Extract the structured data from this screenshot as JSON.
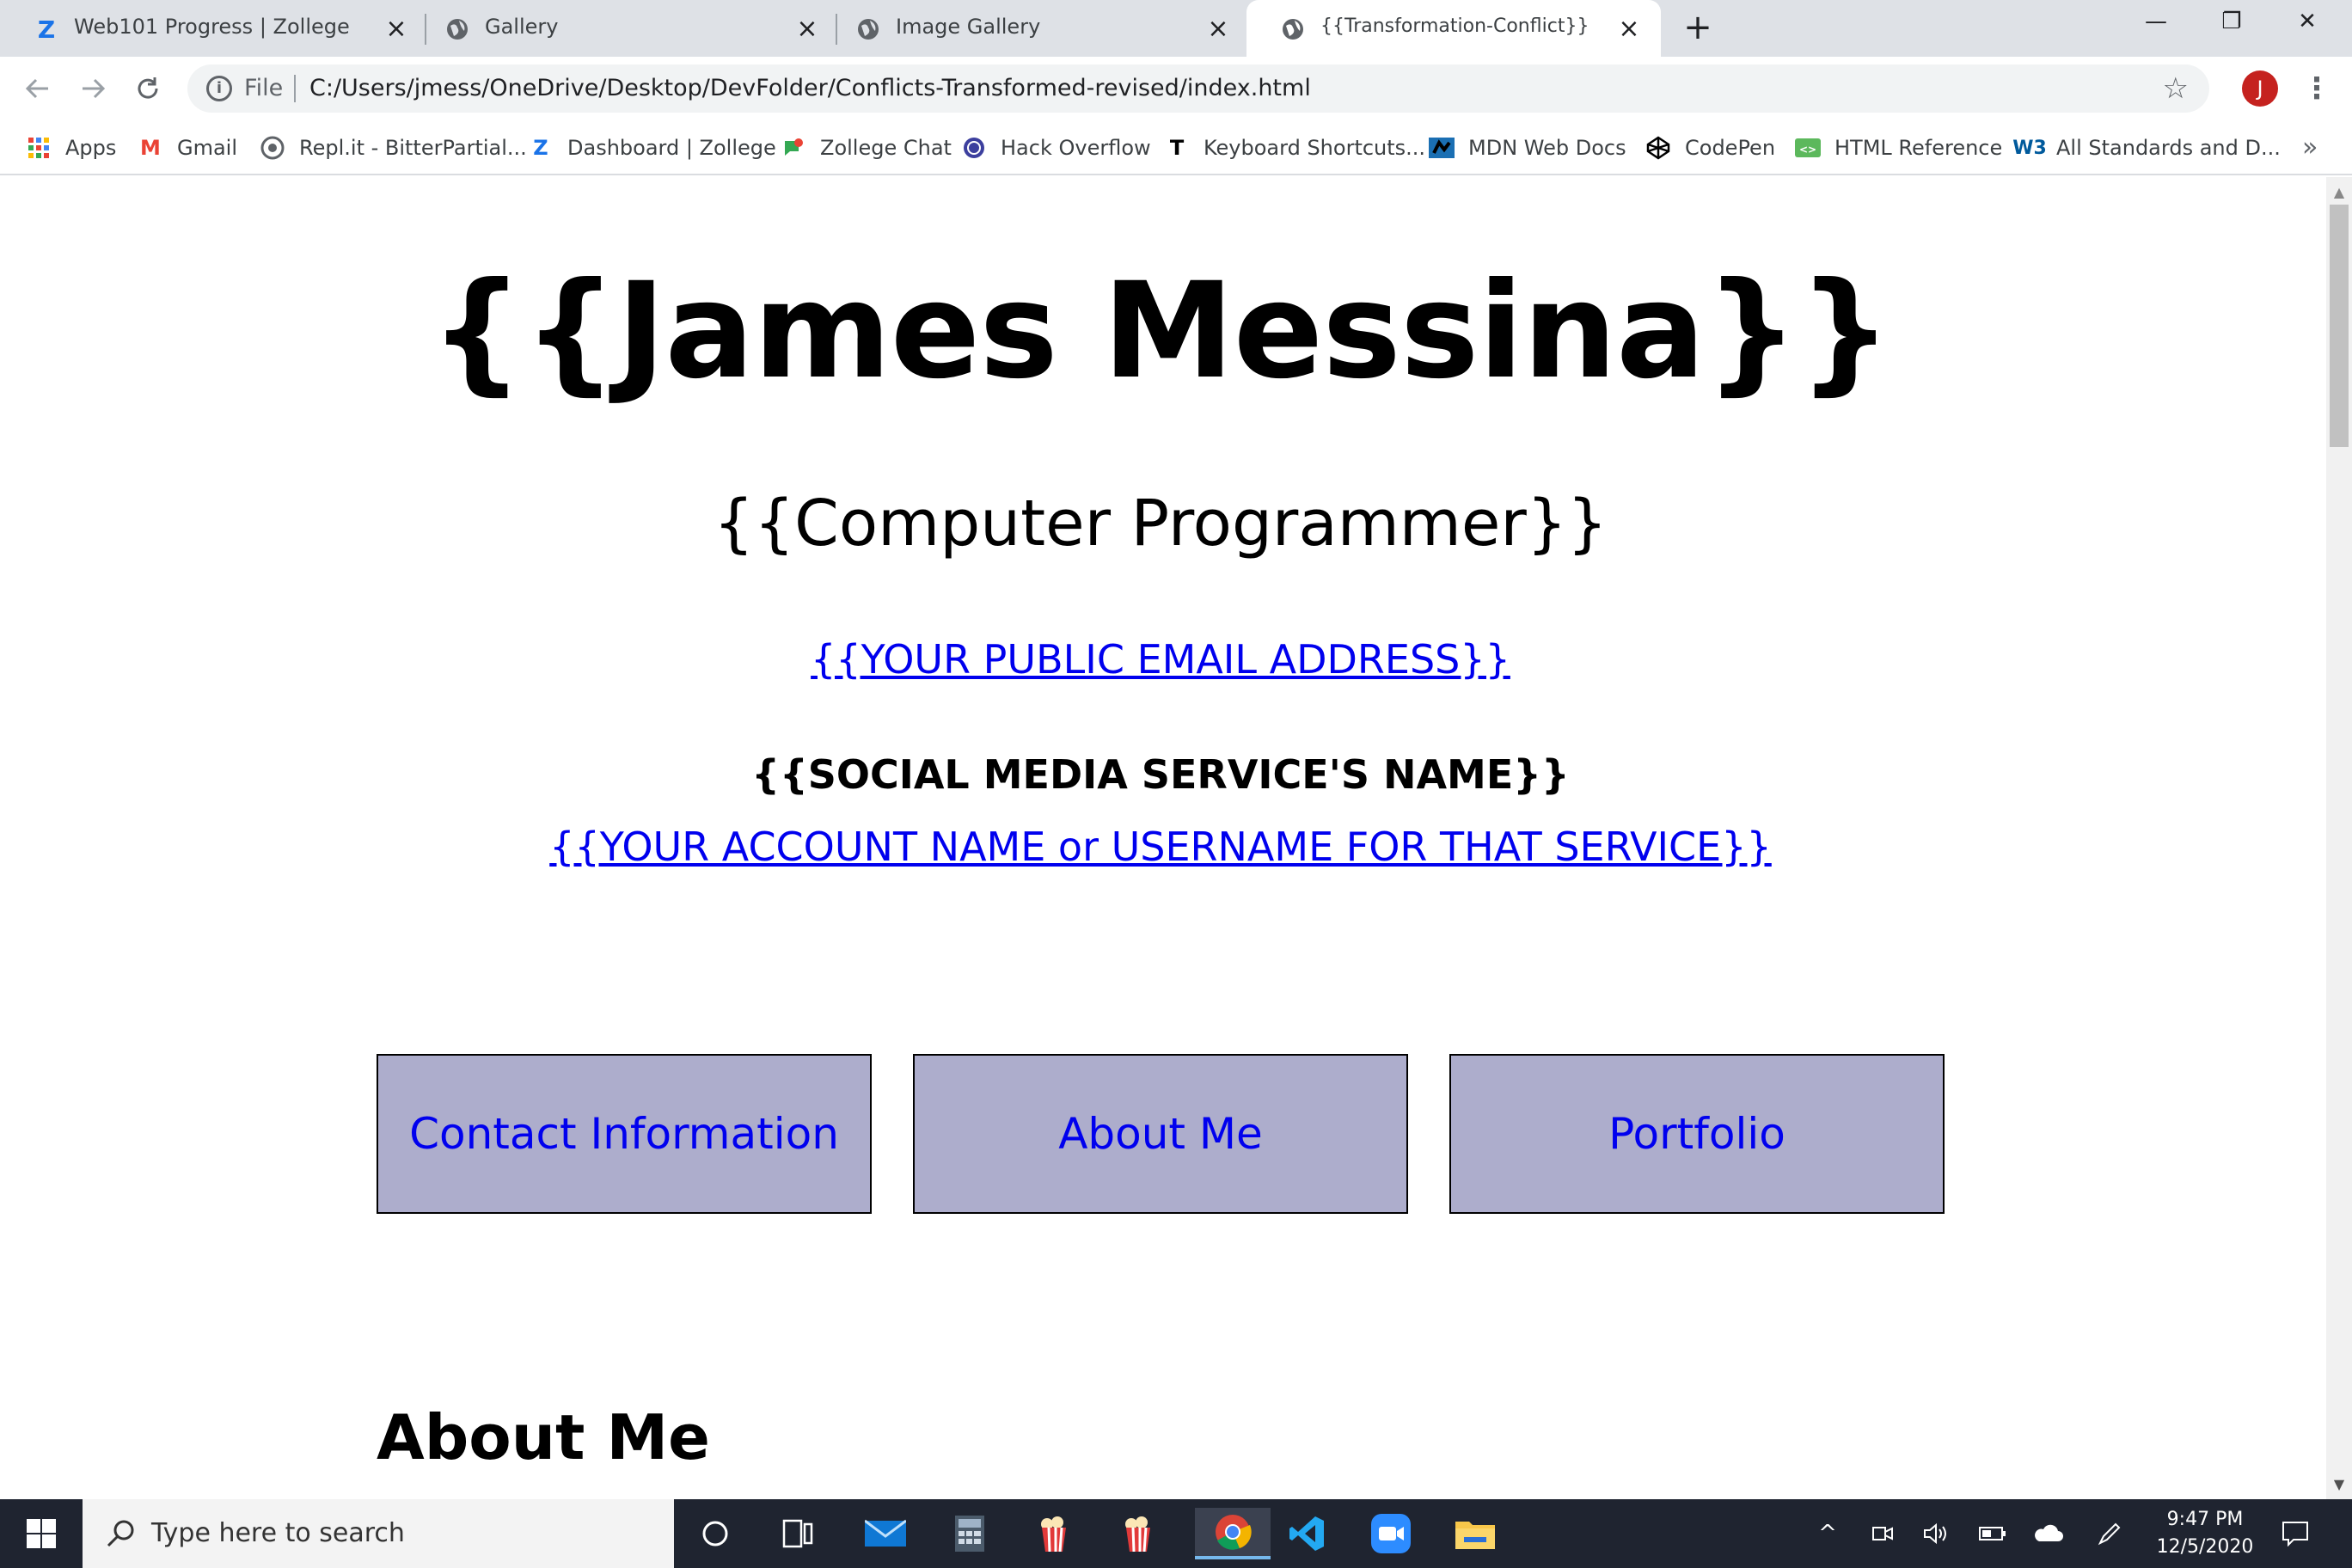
{
  "browser": {
    "tabs": [
      {
        "title": "Web101 Progress | Zollege",
        "icon": "zollege-icon"
      },
      {
        "title": "Gallery",
        "icon": "globe-icon"
      },
      {
        "title": "Image Gallery",
        "icon": "globe-icon"
      },
      {
        "title": "{{Transformation-Conflict}}",
        "icon": "globe-icon",
        "active": true
      }
    ],
    "new_tab": "+",
    "window_controls": {
      "minimize": "—",
      "restore": "❐",
      "close": "✕"
    },
    "address": {
      "scheme_label": "File",
      "url": "C:/Users/jmess/OneDrive/Desktop/DevFolder/Conflicts-Transformed-revised/index.html"
    },
    "profile_initial": "J",
    "bookmarks": [
      {
        "label": "Apps",
        "icon": "apps-grid-icon"
      },
      {
        "label": "Gmail",
        "icon": "gmail-icon"
      },
      {
        "label": "Repl.it - BitterPartial...",
        "icon": "replit-icon"
      },
      {
        "label": "Dashboard | Zollege",
        "icon": "zollege-icon"
      },
      {
        "label": "Zollege Chat",
        "icon": "chat-icon"
      },
      {
        "label": "Hack Overflow",
        "icon": "hack-overflow-icon"
      },
      {
        "label": "Keyboard Shortcuts...",
        "icon": "keyboard-shortcuts-icon"
      },
      {
        "label": "MDN Web Docs",
        "icon": "mdn-icon"
      },
      {
        "label": "CodePen",
        "icon": "codepen-icon"
      },
      {
        "label": "HTML Reference",
        "icon": "html-reference-icon"
      },
      {
        "label": "All Standards and D...",
        "icon": "w3-icon"
      }
    ],
    "bookmarks_more": "»"
  },
  "page": {
    "name": "{{James Messina}}",
    "role": "{{Computer Programmer}}",
    "email_link": "{{YOUR PUBLIC EMAIL ADDRESS}}",
    "social_service": "{{SOCIAL MEDIA SERVICE'S NAME}}",
    "account_link": "{{YOUR ACCOUNT NAME or USERNAME FOR THAT SERVICE}}",
    "nav_buttons": [
      {
        "label": "Contact Information"
      },
      {
        "label": "About Me"
      },
      {
        "label": "Portfolio"
      }
    ],
    "about_heading": "About Me"
  },
  "taskbar": {
    "search_placeholder": "Type here to search",
    "clock_time": "9:47 PM",
    "clock_date": "12/5/2020"
  },
  "colors": {
    "link": "#0000ee",
    "nav_button_bg": "#adadcc",
    "taskbar_bg": "#1f2430",
    "tab_strip_bg": "#dee1e6"
  }
}
